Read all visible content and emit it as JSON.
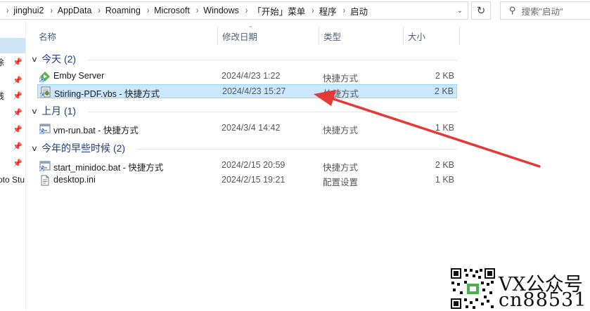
{
  "address": {
    "crumbs": [
      "jinghui2",
      "AppData",
      "Roaming",
      "Microsoft",
      "Windows",
      "「开始」菜单",
      "程序",
      "启动"
    ],
    "refresh_icon": "refresh-icon",
    "search_placeholder": "搜索\"启动\""
  },
  "nav": {
    "fragments": [
      "徐",
      "线",
      "oto Stu"
    ]
  },
  "columns": {
    "name": "名称",
    "date": "修改日期",
    "type": "类型",
    "size": "大小"
  },
  "groups": [
    {
      "title": "今天 (2)",
      "items": [
        {
          "name": "Emby Server",
          "date": "2024/4/23 1:22",
          "type": "快捷方式",
          "size": "2 KB",
          "icon": "emby-icon"
        },
        {
          "name": "Stirling-PDF.vbs - 快捷方式",
          "date": "2024/4/23 15:27",
          "type": "快捷方式",
          "size": "2 KB",
          "icon": "script-shortcut-icon"
        }
      ]
    },
    {
      "title": "上月 (1)",
      "items": [
        {
          "name": "vm-run.bat - 快捷方式",
          "date": "2024/3/4 14:42",
          "type": "快捷方式",
          "size": "1 KB",
          "icon": "batch-shortcut-icon"
        }
      ]
    },
    {
      "title": "今年的早些时候 (2)",
      "items": [
        {
          "name": "start_minidoc.bat - 快捷方式",
          "date": "2024/2/15 20:59",
          "type": "快捷方式",
          "size": "2 KB",
          "icon": "batch-shortcut-icon"
        },
        {
          "name": "desktop.ini",
          "date": "2024/2/15 19:21",
          "type": "配置设置",
          "size": "1 KB",
          "icon": "ini-file-icon"
        }
      ]
    }
  ],
  "selected_item": "Stirling-PDF.vbs - 快捷方式",
  "annotation": {
    "color": "#e53935"
  },
  "watermark": {
    "line1": "VX公众号",
    "line2": "cn88531"
  },
  "colors": {
    "selection_bg": "#cce8ff",
    "selection_border": "#99d1ff",
    "group_title": "#1e3c82"
  }
}
